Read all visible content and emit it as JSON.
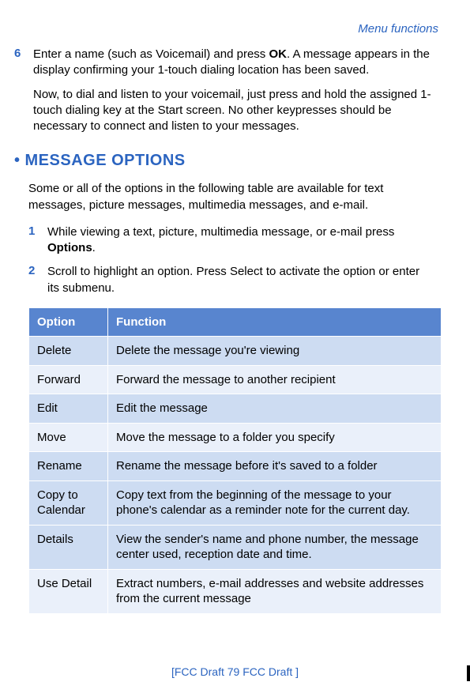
{
  "header": "Menu functions",
  "step6": {
    "num": "6",
    "parts": [
      "Enter a name (such as Voicemail) and press ",
      "OK",
      ". A message appears in the display confirming your 1-touch dialing location has been saved."
    ]
  },
  "step6_cont": "Now, to dial and listen to your voicemail, just press and hold the assigned 1-touch dialing key at the Start screen. No other keypresses should be necessary to connect and listen to your messages.",
  "section_bullet": "•",
  "section_title": "MESSAGE OPTIONS",
  "intro": "Some or all of the options in the following table are available for text messages, picture messages, multimedia messages, and e-mail.",
  "steps": [
    {
      "num": "1",
      "parts": [
        "While viewing a text, picture, multimedia message, or e-mail press ",
        "Options",
        "."
      ]
    },
    {
      "num": "2",
      "parts": [
        "Scroll to highlight an option. Press Select to activate the option or enter its submenu."
      ]
    }
  ],
  "table": {
    "headers": [
      "Option",
      "Function"
    ],
    "rows": [
      {
        "shade": "a",
        "option": "Delete",
        "function": "Delete the message you're viewing"
      },
      {
        "shade": "b",
        "option": "Forward",
        "function": "Forward the message to another recipient"
      },
      {
        "shade": "a",
        "option": "Edit",
        "function": "Edit the message"
      },
      {
        "shade": "b",
        "option": "Move",
        "function": "Move the message to a folder you specify"
      },
      {
        "shade": "a",
        "option": "Rename",
        "function": "Rename the message before it's saved to a folder"
      },
      {
        "shade": "a",
        "option": "Copy to Calendar",
        "function": "Copy text from the beginning of the message to your phone's calendar as a reminder note for the current day."
      },
      {
        "shade": "a",
        "option": "Details",
        "function": "View the sender's name and phone number, the message center used, reception date and time."
      },
      {
        "shade": "b",
        "option": "Use Detail",
        "function": "Extract numbers, e-mail addresses and website addresses from the current message"
      }
    ]
  },
  "footer": "[FCC Draft    79   FCC Draft ]"
}
